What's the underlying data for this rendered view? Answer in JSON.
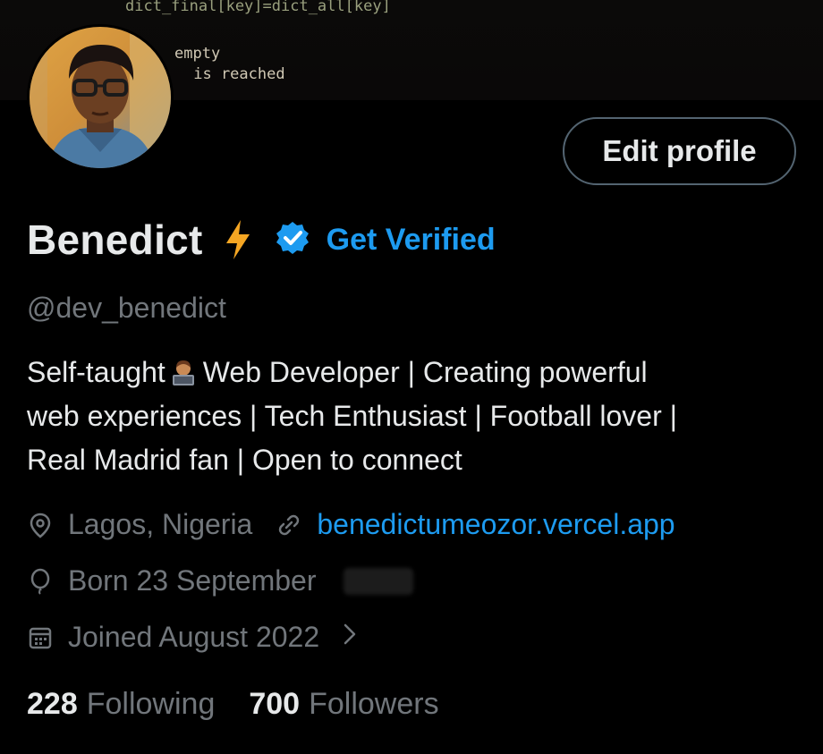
{
  "banner": {
    "code_line_1": "dict_final[key]=dict_all[key]",
    "code_line_2": "empty",
    "code_line_3": " is reached"
  },
  "profile": {
    "name": "Benedict",
    "name_emoji": "lightning-bolt",
    "verified_label": "Get Verified",
    "handle": "@dev_benedict",
    "edit_button_label": "Edit profile"
  },
  "bio": {
    "line1_a": "Self-taught",
    "line1_emoji": "technologist-at-laptop",
    "line1_b": "Web Developer | Creating powerful",
    "line2": "web experiences | Tech Enthusiast | Football lover |",
    "line3": "Real Madrid fan | Open to connect"
  },
  "meta": {
    "location": "Lagos, Nigeria",
    "website": "benedictumeozor.vercel.app",
    "birthday": "Born 23 September",
    "joined": "Joined August 2022"
  },
  "stats": {
    "following_count": "228",
    "following_label": "Following",
    "followers_count": "700",
    "followers_label": "Followers"
  },
  "colors": {
    "background": "#000000",
    "accent": "#1d9bf0",
    "text_primary": "#e7e9ea",
    "text_secondary": "#71767b",
    "bolt": "#f5a623"
  },
  "icons": [
    "location-pin-icon",
    "link-icon",
    "birthday-balloon-icon",
    "calendar-icon",
    "chevron-right-icon",
    "verified-badge-icon",
    "lightning-bolt-icon"
  ]
}
